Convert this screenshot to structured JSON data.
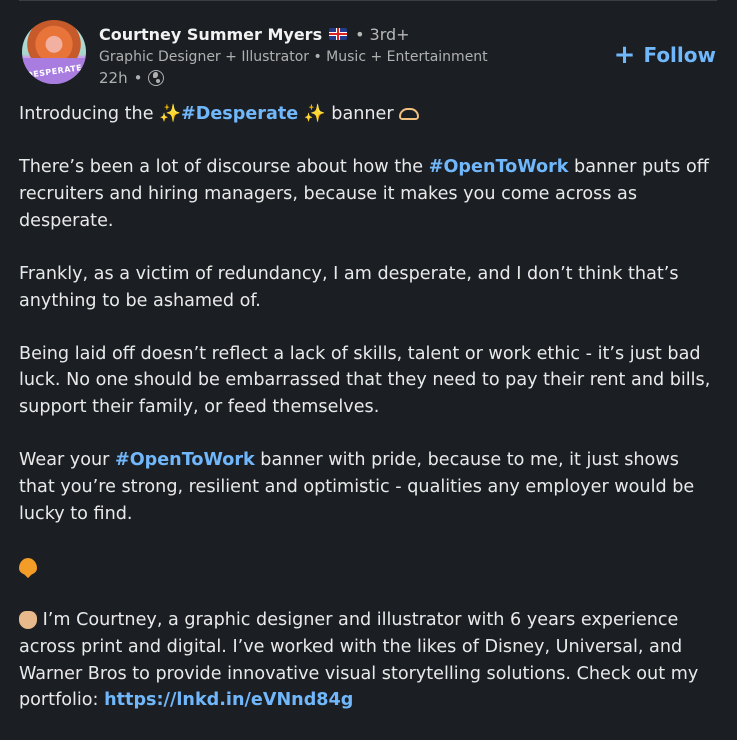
{
  "post": {
    "author_name": "Courtney Summer Myers",
    "separator": "•",
    "connection_degree": "3rd+",
    "headline": "Graphic Designer + Illustrator • Music + Entertainment",
    "time_ago": "22h",
    "meta_separator": "•",
    "avatar_text": "DESPERATE",
    "follow_plus": "+",
    "follow_label": "Follow",
    "icons": {
      "flag": "uk-flag-icon",
      "visibility": "globe-icon",
      "sparkle": "sparkles-icon",
      "heart_hands": "heart-hands-icon",
      "heart": "orange-heart-icon",
      "wave": "waving-hand-icon"
    },
    "colors": {
      "background": "#1b1f23",
      "link": "#71b7fb",
      "text": "#e9e9e9",
      "muted": "#b0b0b0"
    }
  },
  "content": {
    "p1_pre": "Introducing the ",
    "p1_sparkle_left": "✨",
    "p1_tag": "#Desperate",
    "p1_sparkle_right": "✨",
    "p1_post": " banner ",
    "p2_pre": "There’s been a lot of discourse about how the ",
    "p2_tag": "#OpenToWork",
    "p2_post": " banner puts off recruiters and hiring managers, because it makes you come across as desperate.",
    "p3": "Frankly, as a victim of redundancy, I am desperate, and I don’t think that’s anything to be ashamed of.",
    "p4": "Being laid off doesn’t reflect a lack of skills, talent or work ethic - it’s just bad luck. No one should be embarrassed that they need to pay their rent and bills, support their family, or feed themselves.",
    "p5_pre": "Wear your ",
    "p5_tag": "#OpenToWork",
    "p5_post": " banner with pride, because to me, it just shows that you’re strong, resilient and optimistic - qualities any employer would be lucky to find.",
    "p7_text": " I’m Courtney, a graphic designer and illustrator with 6 years experience across print and digital. I’ve worked with the likes of Disney, Universal, and Warner Bros to provide innovative visual storytelling solutions. Check out my portfolio: ",
    "p7_link": "https://lnkd.in/eVNnd84g"
  }
}
